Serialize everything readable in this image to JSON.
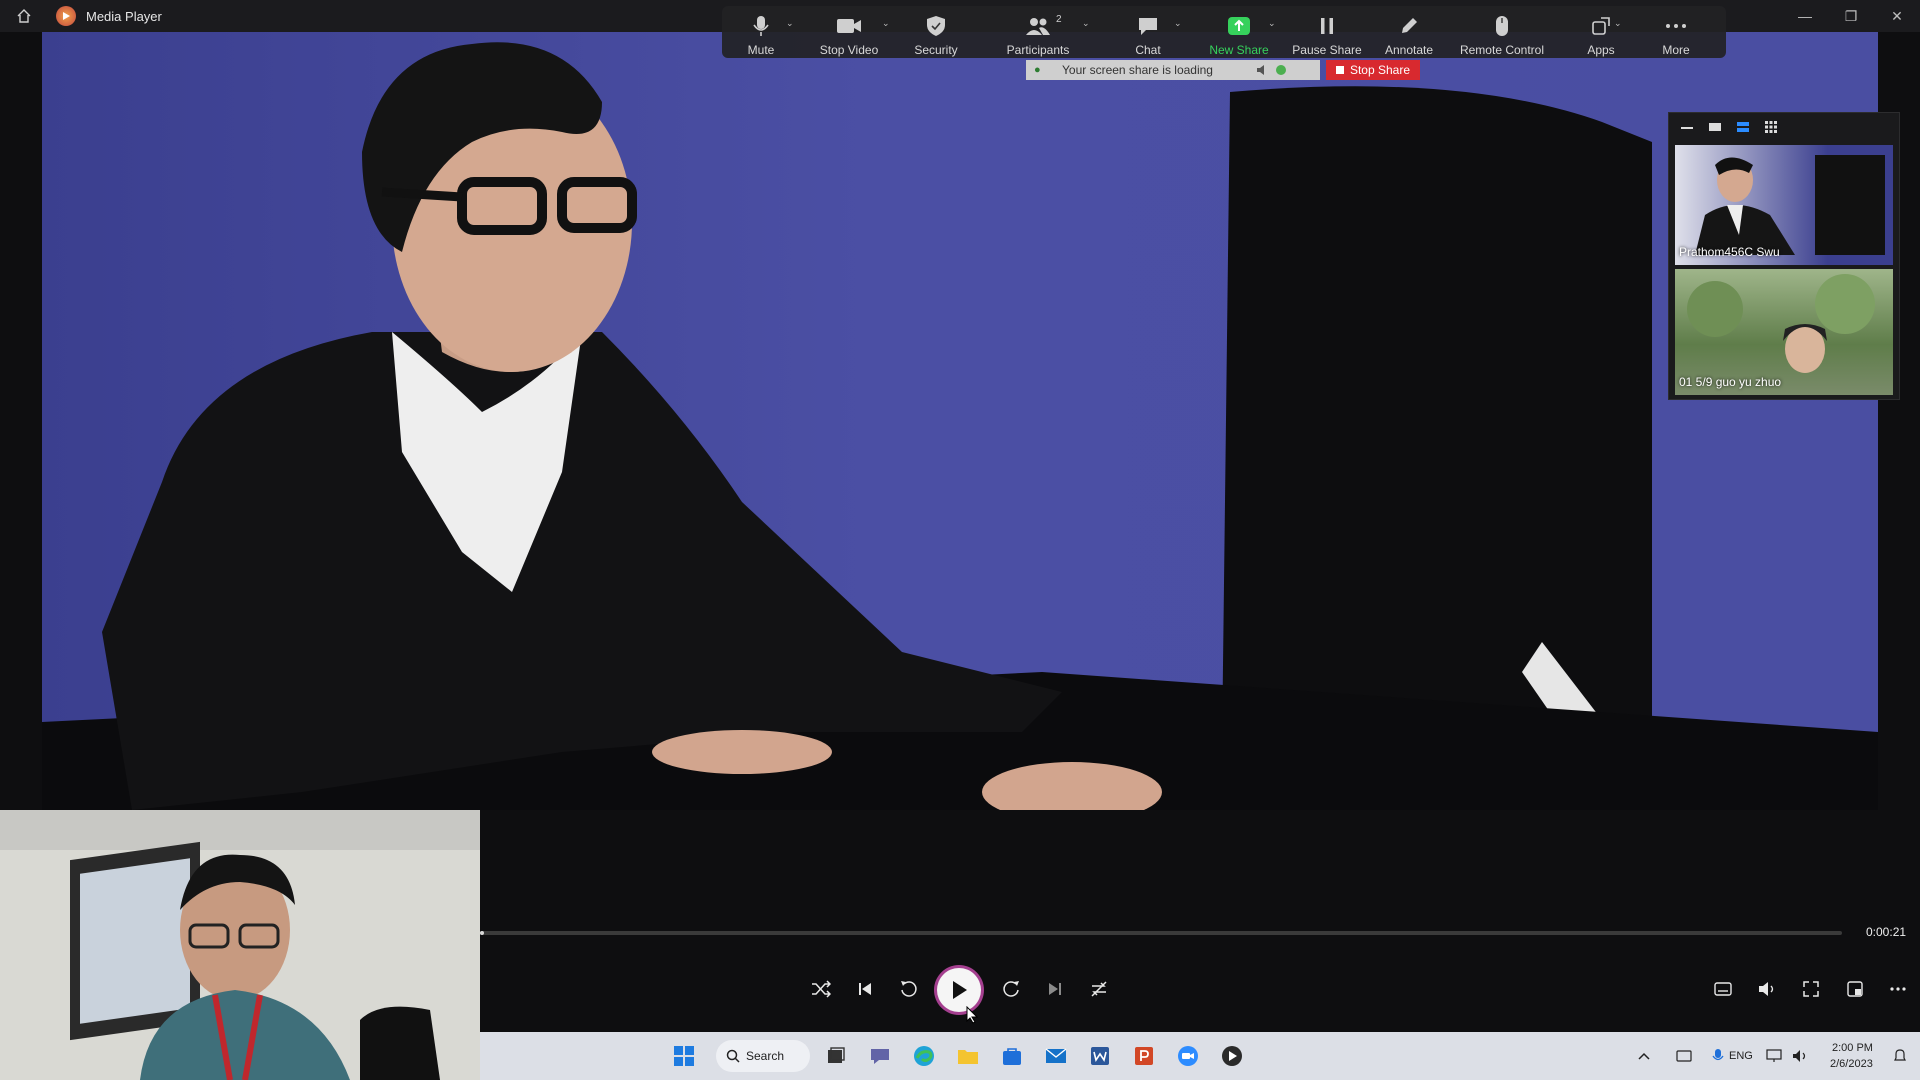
{
  "window": {
    "title": "Media Player"
  },
  "zoom_toolbar": {
    "items": [
      {
        "label": "Mute",
        "icon": "microphone-icon"
      },
      {
        "label": "Stop Video",
        "icon": "video-camera-icon"
      },
      {
        "label": "Security",
        "icon": "shield-icon"
      },
      {
        "label": "Participants",
        "icon": "participants-icon",
        "count": "2"
      },
      {
        "label": "Chat",
        "icon": "chat-icon"
      },
      {
        "label": "New Share",
        "icon": "share-up-arrow-icon"
      },
      {
        "label": "Pause Share",
        "icon": "pause-icon"
      },
      {
        "label": "Annotate",
        "icon": "pencil-icon"
      },
      {
        "label": "Remote Control",
        "icon": "mouse-icon"
      },
      {
        "label": "Apps",
        "icon": "apps-icon"
      },
      {
        "label": "More",
        "icon": "more-dots-icon"
      }
    ]
  },
  "share_banner": {
    "text": "Your screen share is loading",
    "stop_label": "Stop Share"
  },
  "participants": [
    {
      "name": "Prathom456C Swu"
    },
    {
      "name": "01 5/9 guo yu zhuo"
    }
  ],
  "player": {
    "time": "0:00:21",
    "progress": 0.0
  },
  "taskbar": {
    "search_label": "Search",
    "language": "ENG",
    "time": "2:00 PM",
    "date": "2/6/2023"
  },
  "colors": {
    "accent_green": "#36d15c",
    "stop_red": "#d8292f",
    "scene_blue": "#4b4fa4"
  }
}
